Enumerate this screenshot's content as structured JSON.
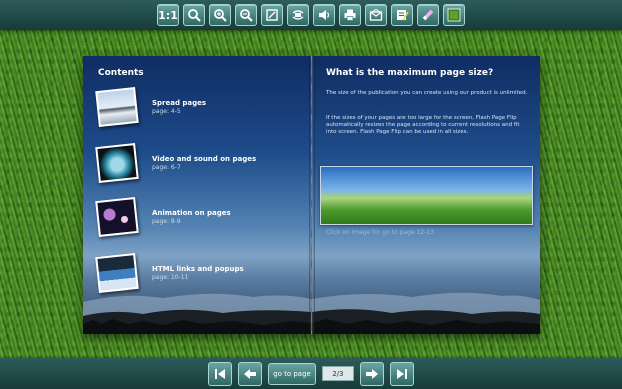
{
  "toolbar": {
    "zoom_actual_label": "1:1"
  },
  "left_page": {
    "title": "Contents",
    "entries": [
      {
        "title": "Spread pages",
        "page": "page: 4-5"
      },
      {
        "title": "Video and sound on pages",
        "page": "page: 6-7"
      },
      {
        "title": "Animation on pages",
        "page": "page: 8-9"
      },
      {
        "title": "HTML links and popups",
        "page": "page: 10-11"
      }
    ]
  },
  "right_page": {
    "title": "What is the maximum page size?",
    "paragraph1": "The size of the publication you can create using our product is unlimited.",
    "paragraph2": "If the sizes of your pages are too large for the screen, Flash Page Flip automatically resizes the page according to current resolutions and fit into screen. Flash Page Flip can be used in all sizes.",
    "caption": "Click on image for go to page 12-13"
  },
  "navigation": {
    "goto_label": "go to page",
    "page_indicator": "2/3"
  }
}
